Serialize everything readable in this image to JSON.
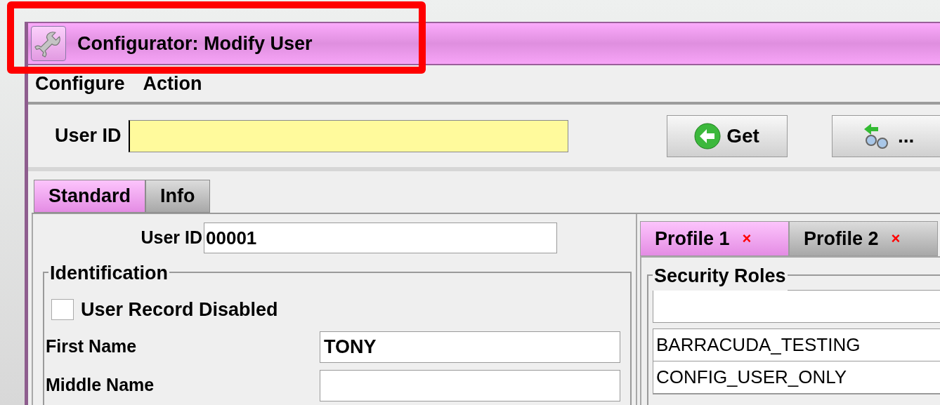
{
  "window": {
    "title": "Configurator: Modify User",
    "title_highlighted": true
  },
  "menu": [
    {
      "label": "Configure"
    },
    {
      "label": "Action"
    }
  ],
  "lookup": {
    "label": "User ID",
    "buttons": [
      {
        "kind": "get",
        "label": "Get"
      },
      {
        "kind": "browse",
        "label": "..."
      }
    ]
  },
  "tabs": [
    {
      "label": "Standard",
      "selected": true
    },
    {
      "label": "Info",
      "selected": false
    }
  ],
  "standard": {
    "user_id": {
      "label": "User ID",
      "value": "00001"
    },
    "identification": {
      "title": "Identification",
      "disabled": {
        "label": "User Record Disabled",
        "checked": false
      },
      "fields": [
        {
          "label": "First Name",
          "value": "TONY"
        },
        {
          "label": "Middle Name"
        }
      ]
    }
  },
  "profile_tabs": [
    {
      "label": "Profile 1",
      "close": "×",
      "selected": true
    },
    {
      "label": "Profile 2",
      "close": "×",
      "selected": false
    }
  ],
  "security_roles": {
    "title": "Security Roles",
    "items": [
      {
        "label": "BARRACUDA_TESTING"
      },
      {
        "label": "CONFIG_USER_ONLY"
      }
    ]
  }
}
